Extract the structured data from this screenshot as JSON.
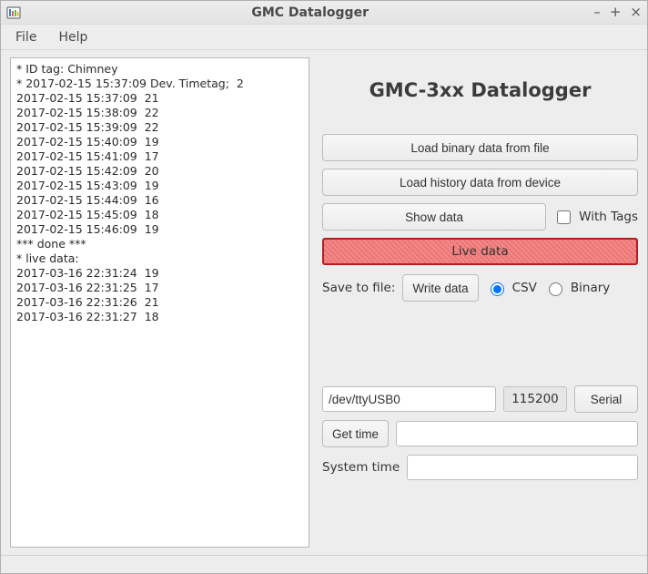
{
  "window": {
    "title": "GMC Datalogger"
  },
  "menu": {
    "file": "File",
    "help": "Help"
  },
  "log_lines": [
    "* ID tag: Chimney",
    "* 2017-02-15 15:37:09 Dev. Timetag;  2",
    "2017-02-15 15:37:09  21",
    "2017-02-15 15:38:09  22",
    "2017-02-15 15:39:09  22",
    "2017-02-15 15:40:09  19",
    "2017-02-15 15:41:09  17",
    "2017-02-15 15:42:09  20",
    "2017-02-15 15:43:09  19",
    "2017-02-15 15:44:09  16",
    "2017-02-15 15:45:09  18",
    "2017-02-15 15:46:09  19",
    "*** done ***",
    "* live data:",
    "2017-03-16 22:31:24  19",
    "2017-03-16 22:31:25  17",
    "2017-03-16 22:31:26  21",
    "2017-03-16 22:31:27  18"
  ],
  "right": {
    "title": "GMC-3xx Datalogger",
    "load_file": "Load binary data from file",
    "load_device": "Load history data from device",
    "show_data": "Show data",
    "with_tags": "With Tags",
    "live_data": "Live data",
    "save_to_file": "Save to file:",
    "write_data": "Write data",
    "csv": "CSV",
    "binary": "Binary",
    "device_path": "/dev/ttyUSB0",
    "baud": "115200",
    "serial": "Serial",
    "get_time": "Get time",
    "system_time": "System time"
  }
}
